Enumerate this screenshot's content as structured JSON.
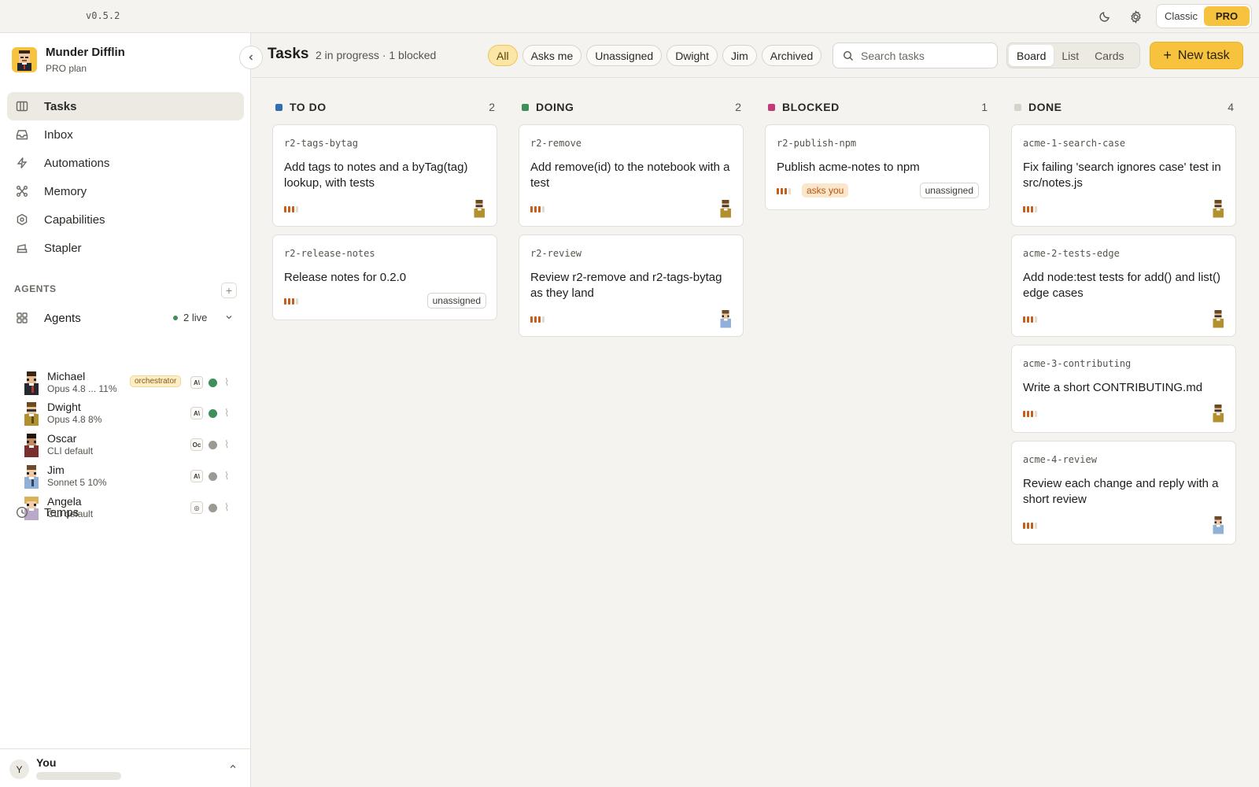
{
  "topbar": {
    "version": "v0.5.2",
    "mode_classic": "Classic",
    "mode_pro": "PRO"
  },
  "org": {
    "name": "Munder Difflin",
    "plan": "PRO plan"
  },
  "nav": [
    {
      "label": "Tasks",
      "icon": "columns-icon",
      "active": true
    },
    {
      "label": "Inbox",
      "icon": "inbox-icon"
    },
    {
      "label": "Automations",
      "icon": "bolt-icon"
    },
    {
      "label": "Memory",
      "icon": "graph-icon"
    },
    {
      "label": "Capabilities",
      "icon": "hexagon-icon"
    },
    {
      "label": "Stapler",
      "icon": "stapler-icon"
    }
  ],
  "agents_section": {
    "header": "AGENTS",
    "row_label": "Agents",
    "live": "2 live"
  },
  "agents": [
    {
      "name": "Michael",
      "meta": "Opus 4.8 ...  11%",
      "role": "orchestrator",
      "provider": "A\\",
      "status": "online",
      "status_color": "#3f8f5a"
    },
    {
      "name": "Dwight",
      "meta": "Opus 4.8  8%",
      "role": "",
      "provider": "A\\",
      "status": "online",
      "status_color": "#3f8f5a"
    },
    {
      "name": "Oscar",
      "meta": "CLI default",
      "role": "",
      "provider": "Oc",
      "status": "offline",
      "status_color": "#9c9a92"
    },
    {
      "name": "Jim",
      "meta": "Sonnet 5  10%",
      "role": "",
      "provider": "A\\",
      "status": "offline",
      "status_color": "#9c9a92"
    },
    {
      "name": "Angela",
      "meta": "CLI default",
      "role": "",
      "provider": "◎",
      "status": "offline",
      "status_color": "#9c9a92"
    }
  ],
  "temps": {
    "label": "Temps"
  },
  "user": {
    "initial": "Y",
    "name": "You"
  },
  "toolbar": {
    "title": "Tasks",
    "subtitle": "2 in progress · 1 blocked",
    "filters": [
      "All",
      "Asks me",
      "Unassigned",
      "Dwight",
      "Jim",
      "Archived"
    ],
    "search_placeholder": "Search tasks",
    "views": [
      "Board",
      "List",
      "Cards"
    ],
    "new_task": "New task"
  },
  "columns": [
    {
      "name": "TO DO",
      "count": "2",
      "color": "#2f6fb0",
      "cards": [
        {
          "id": "r2-tags-bytag",
          "title": "Add tags to notes and a byTag(tag) lookup, with tests",
          "priority": 3,
          "assignee": "Dwight"
        },
        {
          "id": "r2-release-notes",
          "title": "Release notes for 0.2.0",
          "priority": 3,
          "tag": "unassigned"
        }
      ]
    },
    {
      "name": "DOING",
      "count": "2",
      "color": "#3f8f5a",
      "cards": [
        {
          "id": "r2-remove",
          "title": "Add remove(id) to the notebook with a test",
          "priority": 3,
          "assignee": "Dwight"
        },
        {
          "id": "r2-review",
          "title": "Review r2-remove and r2-tags-bytag as they land",
          "priority": 3,
          "assignee": "Jim"
        }
      ]
    },
    {
      "name": "BLOCKED",
      "count": "1",
      "color": "#c23a7a",
      "cards": [
        {
          "id": "r2-publish-npm",
          "title": "Publish acme-notes to npm",
          "priority": 3,
          "asks": "asks you",
          "tag": "unassigned"
        }
      ]
    },
    {
      "name": "DONE",
      "count": "4",
      "color": "#d6d3ca",
      "cards": [
        {
          "id": "acme-1-search-case",
          "title": "Fix failing 'search ignores case' test in src/notes.js",
          "priority": 3,
          "assignee": "Dwight"
        },
        {
          "id": "acme-2-tests-edge",
          "title": "Add node:test tests for add() and list() edge cases",
          "priority": 3,
          "assignee": "Dwight"
        },
        {
          "id": "acme-3-contributing",
          "title": "Write a short CONTRIBUTING.md",
          "priority": 3,
          "assignee": "Dwight"
        },
        {
          "id": "acme-4-review",
          "title": "Review each change and reply with a short review",
          "priority": 3,
          "assignee": "Jim"
        }
      ]
    }
  ],
  "colors": {
    "accent": "#f7c23d",
    "priority_on": "#c75d1c",
    "live": "#3f8f5a"
  }
}
